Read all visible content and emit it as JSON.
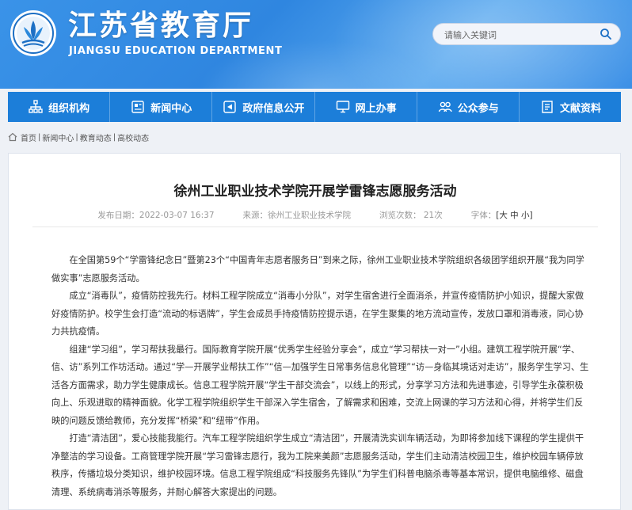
{
  "site": {
    "title": "江苏省教育厅",
    "subtitle": "JIANGSU EDUCATION DEPARTMENT"
  },
  "search": {
    "placeholder": "请输入关键词"
  },
  "nav": [
    {
      "label": "组织机构",
      "icon": "org-chart-icon"
    },
    {
      "label": "新闻中心",
      "icon": "news-icon"
    },
    {
      "label": "政府信息公开",
      "icon": "info-open-icon"
    },
    {
      "label": "网上办事",
      "icon": "online-service-icon"
    },
    {
      "label": "公众参与",
      "icon": "participation-icon"
    },
    {
      "label": "文献资料",
      "icon": "documents-icon"
    }
  ],
  "breadcrumb": [
    "首页",
    "新闻中心",
    "教育动态",
    "高校动态"
  ],
  "article": {
    "title": "徐州工业职业技术学院开展学雷锋志愿服务活动",
    "publish": "发布日期：2022-03-07 16:37",
    "source": "来源：徐州工业职业技术学院",
    "views": "浏览次数：  21次",
    "font_label": "字体：",
    "font_sizes": "[大 中 小]",
    "paragraphs": [
      "在全国第59个“学雷锋纪念日”暨第23个“中国青年志愿者服务日”到来之际，徐州工业职业技术学院组织各级团学组织开展“我为同学做实事”志愿服务活动。",
      "成立“消毒队”，疫情防控我先行。材料工程学院成立“消毒小分队”，对学生宿舍进行全面消杀，并宣传疫情防护小知识，提醒大家做好疫情防护。校学生会打造“流动的标语牌”，学生会成员手持疫情防控提示语，在学生聚集的地方流动宣传，发放口罩和消毒液，同心协力共抗疫情。",
      "组建“学习组”，学习帮扶我最行。国际教育学院开展“优秀学生经验分享会”，成立“学习帮扶一对一”小组。建筑工程学院开展“学、信、访”系列工作坊活动。通过“学—开展学业帮扶工作”“信—加强学生日常事务信息化管理”“访—身临其境话对走访”，服务学生学习、生活各方面需求，助力学生健康成长。信息工程学院开展“学生干部交流会”，以线上的形式，分享学习方法和先进事迹，引导学生永葆积极向上、乐观进取的精神面貌。化学工程学院组织学生干部深入学生宿舍，了解需求和困难，交流上网课的学习方法和心得，并将学生们反映的问题反馈给教师，充分发挥“桥梁”和“纽带”作用。",
      "打造“清洁团”，爱心技能我能行。汽车工程学院组织学生成立“清洁团”，开展清洗实训车辆活动，为即将参加线下课程的学生提供干净整洁的学习设备。工商管理学院开展“学习雷锋志愿行，我为工院来美颜”志愿服务活动，学生们主动清洁校园卫生，维护校园车辆停放秩序，传播垃圾分类知识，维护校园环境。信息工程学院组成“科技服务先锋队”为学生们科普电脑杀毒等基本常识，提供电脑维修、磁盘清理、系统病毒消杀等服务，并耐心解答大家提出的问题。"
    ]
  },
  "colors": {
    "banner": "#3a93e8",
    "nav": "#1c7ed9",
    "text": "#333333"
  }
}
